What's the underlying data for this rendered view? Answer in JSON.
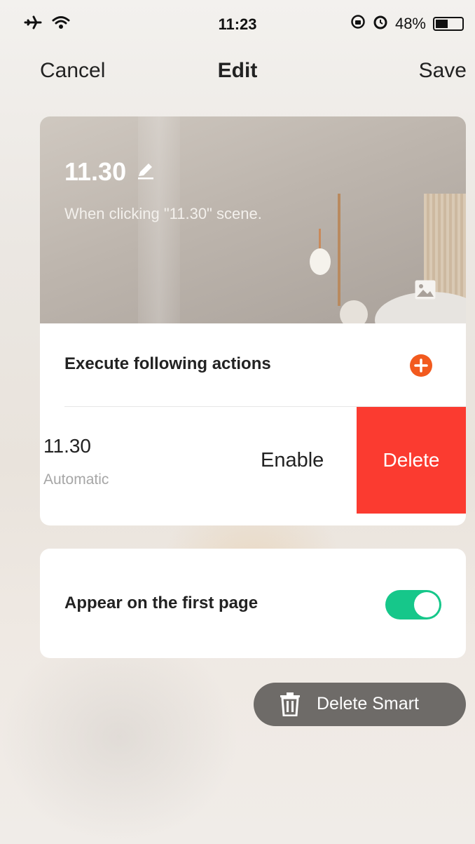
{
  "status_bar": {
    "time": "11:23",
    "battery_text": "48%",
    "battery_level": 0.48,
    "icons": [
      "airplane-icon",
      "wifi-icon",
      "orientation-lock-icon",
      "alarm-icon",
      "battery-icon"
    ]
  },
  "nav": {
    "cancel": "Cancel",
    "title": "Edit",
    "save": "Save"
  },
  "scene": {
    "name": "11.30",
    "description": "When clicking \"11.30\" scene."
  },
  "actions_section": {
    "header": "Execute following actions",
    "items": [
      {
        "name": "11.30",
        "type": "Automatic",
        "enable_label": "Enable",
        "delete_label": "Delete"
      }
    ]
  },
  "settings": {
    "appear_label": "Appear on the first page",
    "appear_enabled": true
  },
  "delete_smart": {
    "label": "Delete Smart"
  },
  "colors": {
    "add_button": "#f25a1e",
    "delete_red": "#fb3b30",
    "toggle_on": "#16c78a",
    "delete_smart_bg": "#6e6b68"
  }
}
